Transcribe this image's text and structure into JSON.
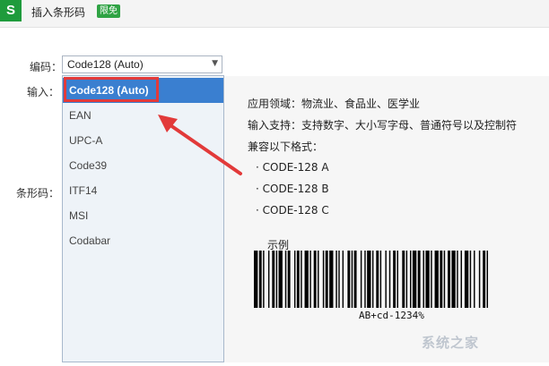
{
  "window": {
    "title": "插入条形码",
    "badge": "限免",
    "logo_letter": "S"
  },
  "form": {
    "encoding_label": "编码：",
    "input_label": "输入：",
    "barcode_label": "条形码：",
    "encoding_value": "Code128 (Auto)"
  },
  "dropdown": {
    "options": [
      "Code128 (Auto)",
      "EAN",
      "UPC-A",
      "Code39",
      "ITF14",
      "MSI",
      "Codabar"
    ],
    "selected_index": 0
  },
  "info": {
    "line1": "应用领域：物流业、食品业、医学业",
    "line2": "输入支持：支持数字、大小写字母、普通符号以及控制符",
    "line3": "兼容以下格式：",
    "formats": [
      "· CODE-128 A",
      "· CODE-128 B",
      "· CODE-128 C"
    ]
  },
  "sample": {
    "label": "示例",
    "barcode_text": "AB+cd-1234%"
  },
  "watermark": "系统之家",
  "colors": {
    "brand": "#1e9b3c",
    "selection": "#3a7fd0",
    "annotation": "#e23a3a"
  }
}
